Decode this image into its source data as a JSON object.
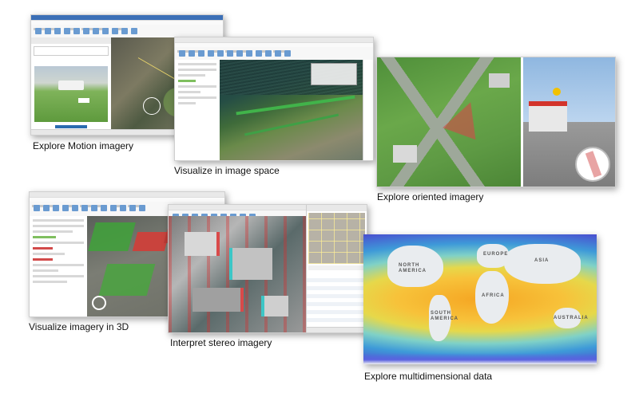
{
  "captions": {
    "motion": "Explore Motion imagery",
    "image_space": "Visualize in image space",
    "oriented": "Explore oriented imagery",
    "imagery_3d": "Visualize imagery in 3D",
    "stereo": "Interpret stereo imagery",
    "multidimensional": "Explore multidimensional data"
  },
  "map_labels": {
    "north_america": "NORTH AMERICA",
    "europe": "EUROPE",
    "asia": "ASIA",
    "africa": "AFRICA",
    "south_america": "SOUTH AMERICA",
    "australia": "AUSTRALIA"
  },
  "colors": {
    "accent": "#2b6cb0",
    "vegetation_overlay": "#4caf50",
    "selection_red": "#d24a4a",
    "sea_warm": "#f5a623",
    "sea_cold": "#3b5bd6"
  },
  "icons": [
    "video-player-icon",
    "map-pin-icon",
    "camera-cone-icon"
  ]
}
